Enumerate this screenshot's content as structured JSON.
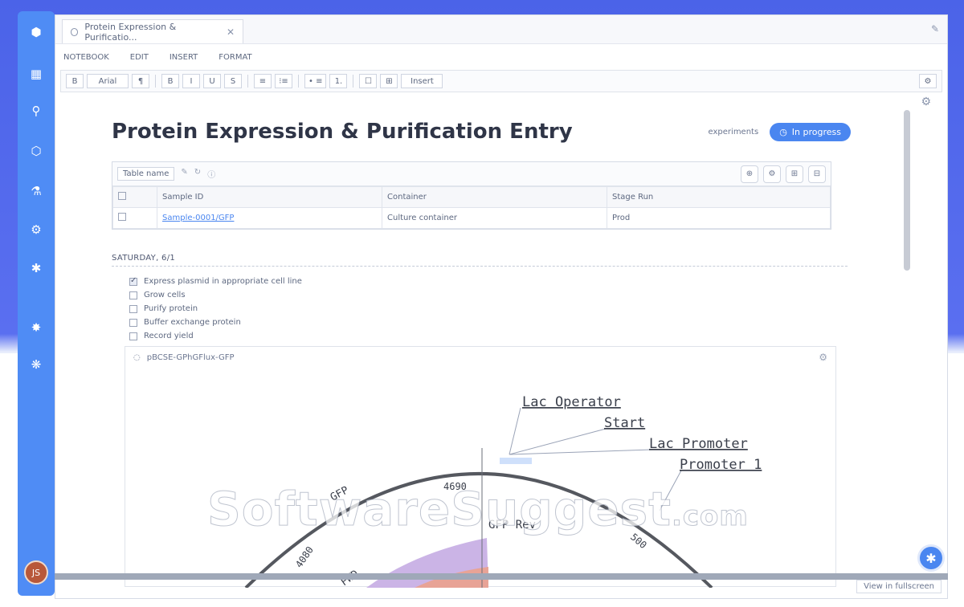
{
  "window": {
    "tab_title": "Protein Expression & Purificatio...",
    "tab_close": "✕",
    "pin_icon": "✎"
  },
  "rail": {
    "icons": [
      "home-icon",
      "notebook-icon",
      "inventory-icon",
      "molecule-icon",
      "flask-icon",
      "report-icon",
      "settings-icon",
      "bug-icon",
      "star-icon"
    ],
    "avatar_initials": "JS"
  },
  "menu": [
    "NOTEBOOK",
    "EDIT",
    "INSERT",
    "FORMAT"
  ],
  "toolbar": {
    "items": [
      "B",
      "Arial",
      "¶",
      "B",
      "I",
      "U",
      "S",
      "≡",
      "⁝≡",
      "• ≡",
      "1.",
      "☐",
      "⊞",
      "Insert"
    ],
    "right": "⚙"
  },
  "entry": {
    "title": "Protein Expression & Purification Entry",
    "meta": "experiments",
    "status": "In progress"
  },
  "table": {
    "name": "Table name",
    "columns": [
      "",
      "Sample ID",
      "Container",
      "Stage Run"
    ],
    "rows": [
      {
        "check": "",
        "sample_id": "Sample-0001/GFP",
        "container": "Culture container",
        "stage_run": "Prod"
      }
    ],
    "actions": [
      "⊕",
      "⚙",
      "⊞",
      "⊟"
    ]
  },
  "checklist": {
    "label": "SATURDAY, 6/1",
    "items": [
      {
        "text": "Express plasmid in appropriate cell line",
        "checked": true
      },
      {
        "text": "Grow cells",
        "checked": false
      },
      {
        "text": "Purify protein",
        "checked": false
      },
      {
        "text": "Buffer exchange protein",
        "checked": false
      },
      {
        "text": "Record yield",
        "checked": false
      }
    ]
  },
  "plasmid": {
    "name": "pBCSE-GPhGFlux-GFP",
    "labels": {
      "lac_operator": "Lac Operator",
      "start": "Start",
      "lac_promoter": "Lac Promoter",
      "promoter": "Promoter 1",
      "gfp": "GFP",
      "pos_4690": "4690",
      "gfp_rev": "GFP Rev",
      "pos_4080": "4080",
      "fwd": "FWD",
      "pos_500": "500"
    }
  },
  "watermark": {
    "main": "SoftwareSuggest",
    "suffix": ".com"
  },
  "footer": {
    "link": "View in fullscreen"
  },
  "colors": {
    "accent": "#4a86f0",
    "rail": "#4f8cf5",
    "feature_purple": "#cbb4e6",
    "feature_salmon": "#e8a396"
  }
}
